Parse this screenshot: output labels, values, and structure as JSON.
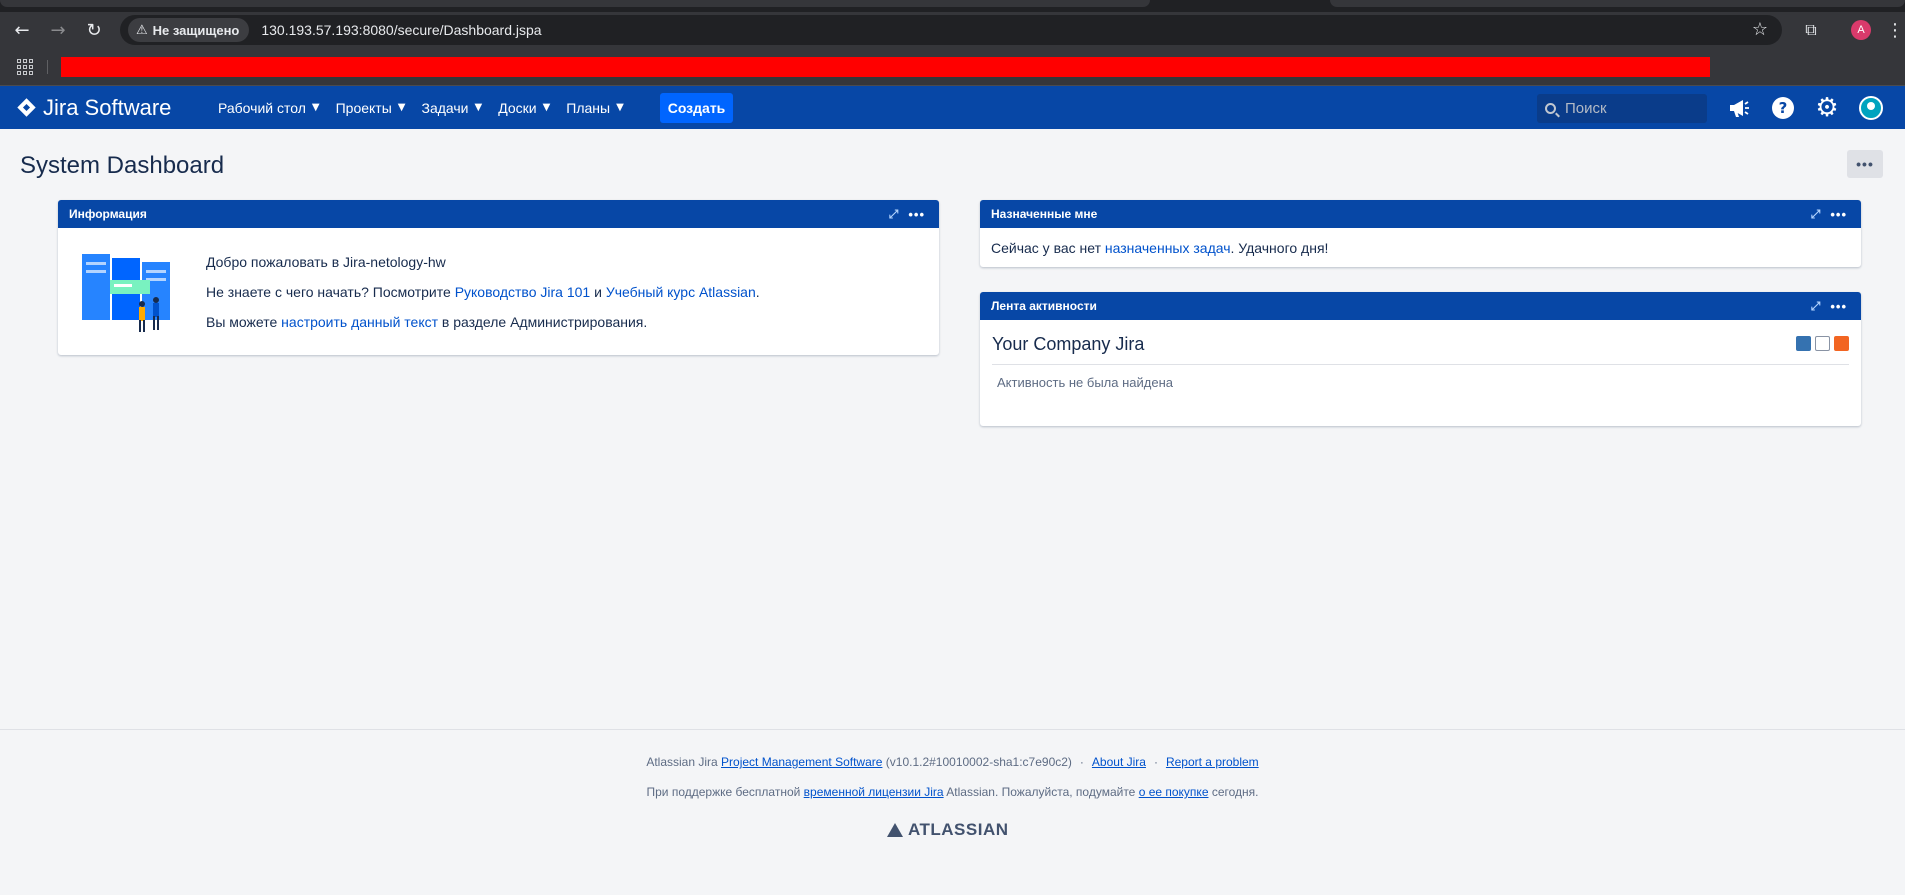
{
  "browser": {
    "security_label": "Не защищено",
    "url": "130.193.57.193:8080/secure/Dashboard.jspa",
    "profile_initial": "A"
  },
  "jira": {
    "product_name": "Jira Software",
    "menu": [
      {
        "label": "Рабочий стол"
      },
      {
        "label": "Проекты"
      },
      {
        "label": "Задачи"
      },
      {
        "label": "Доски"
      },
      {
        "label": "Планы"
      }
    ],
    "create_label": "Создать",
    "search_placeholder": "Поиск",
    "colors": {
      "header": "#0747a6",
      "create_button": "#0065ff",
      "link": "#0052cc"
    }
  },
  "page": {
    "title": "System Dashboard",
    "more_label": "•••"
  },
  "gadgets": {
    "info": {
      "title": "Информация",
      "welcome": "Добро пожаловать в Jira-netology-hw",
      "start_text_1": "Не знаете с чего начать? Посмотрите ",
      "start_link_1": "Руководство Jira 101",
      "start_and": " и ",
      "start_link_2": "Учебный курс Atlassian",
      "start_end": ".",
      "admin_text_1": "Вы можете ",
      "admin_link": "настроить данный текст",
      "admin_text_2": " в разделе Администрирования."
    },
    "assigned": {
      "title": "Назначенные мне",
      "text_1": "Сейчас у вас нет ",
      "link": "назначенных задач",
      "text_2": ". Удачного дня!"
    },
    "activity": {
      "title": "Лента активности",
      "stream_title": "Your Company Jira",
      "empty": "Активность не была найдена"
    }
  },
  "footer": {
    "line1_prefix": "Atlassian Jira ",
    "line1_link": "Project Management Software",
    "line1_version": " (v10.1.2#10010002-sha1:c7e90c2)",
    "about": "About Jira",
    "report": "Report a problem",
    "line2_a": "При поддержке бесплатной ",
    "line2_link1": "временной лицензии Jira",
    "line2_b": " Atlassian. Пожалуйста, подумайте ",
    "line2_link2": "о ее покупке",
    "line2_c": " сегодня.",
    "brand": "ATLASSIAN"
  }
}
